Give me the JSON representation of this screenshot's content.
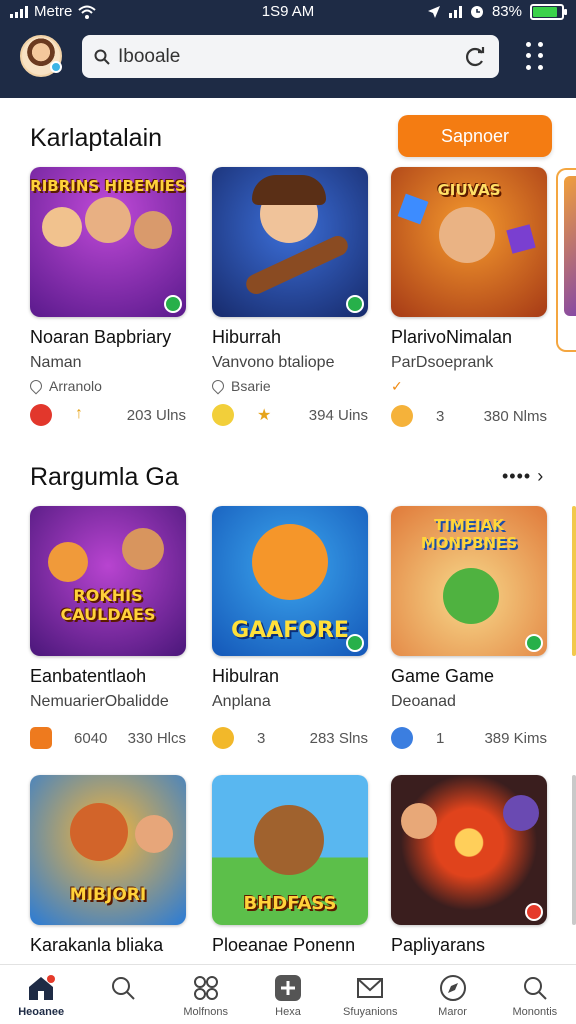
{
  "status": {
    "carrier": "Metre",
    "time": "1S9 AM",
    "battery": "83%"
  },
  "header": {
    "search_value": "Ibooale",
    "search_placeholder": "Ibooale"
  },
  "section1": {
    "title": "Karlaptalain",
    "cta_label": "Sapnoer",
    "cards": [
      {
        "thumb_text": "RIBRINS HIBEMIES",
        "title": "Noaran Bapbriary",
        "subtitle": "Naman",
        "location": "Arranolo",
        "count": "203 Ulns"
      },
      {
        "thumb_text": "",
        "title": "Hiburrah",
        "subtitle": "Vanvono btaliope",
        "location": "Bsarie",
        "count": "394 Uins"
      },
      {
        "thumb_text": "GIUVAS",
        "title": "PlarivoNimalan",
        "subtitle": "ParDsoeprank",
        "location": "",
        "rating": "3",
        "count": "380 Nlms"
      }
    ]
  },
  "section2": {
    "title": "Rargumla Ga",
    "more_label": "•••• ›",
    "cards": [
      {
        "thumb_text": "ROKHIS CAULDAES",
        "title": "Eanbatentlaoh",
        "subtitle": "NemuarierObalidde",
        "rating": "6040",
        "count": "330 Hlcs"
      },
      {
        "thumb_text": "GAAFORE",
        "title": "Hibulran",
        "subtitle": "Anplana",
        "rating": "3",
        "count": "283 Slns"
      },
      {
        "thumb_text": "TIMEIAK MONPBNES",
        "title": "Game Game",
        "subtitle": "Deoanad",
        "rating": "1",
        "count": "389 Kims"
      }
    ]
  },
  "section3": {
    "cards": [
      {
        "thumb_text": "MIBJORI",
        "title": "Karakanla bliaka"
      },
      {
        "thumb_text": "BHDFASS",
        "title": "Ploeanae Ponenn"
      },
      {
        "thumb_text": "",
        "title": "Papliyarans"
      }
    ]
  },
  "nav": [
    {
      "label": "Heoanee",
      "icon": "home-icon"
    },
    {
      "label": "",
      "icon": "search-icon"
    },
    {
      "label": "Molfnons",
      "icon": "games-icon"
    },
    {
      "label": "Hexa",
      "icon": "add-icon"
    },
    {
      "label": "Sfuyanions",
      "icon": "inbox-icon"
    },
    {
      "label": "Maror",
      "icon": "compass-icon"
    },
    {
      "label": "Monontis",
      "icon": "search-icon"
    }
  ],
  "colors": {
    "header_bg": "#1e2b45",
    "accent": "#f47c12",
    "battery": "#3ad24a"
  }
}
